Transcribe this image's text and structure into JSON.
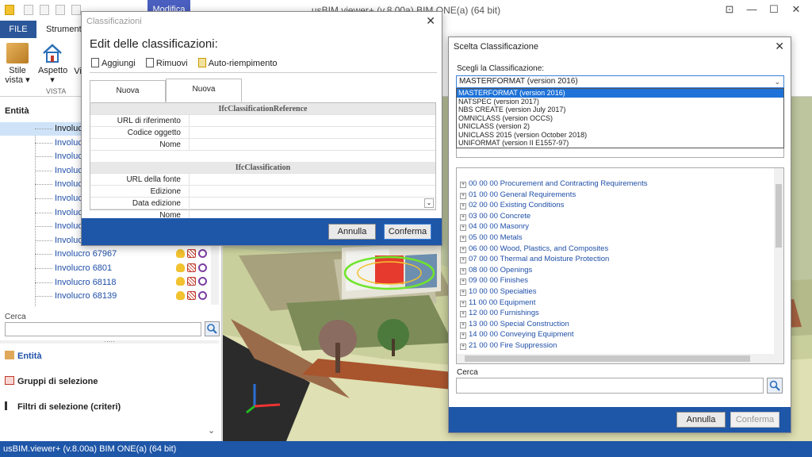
{
  "app": {
    "title": "usBIM.viewer+ (v.8.00a)  BIM ONE(a) (64 bit)",
    "context_tab": "Modifica",
    "win_controls": [
      "⊡",
      "—",
      "☐",
      "✕"
    ]
  },
  "ribbon": {
    "file_tab": "FILE",
    "tabs": [
      "Strumenti"
    ],
    "buttons": [
      {
        "label": "Stile\nvista ▾",
        "icon": "box-icon"
      },
      {
        "label": "Aspetto\n▾",
        "icon": "house-icon"
      },
      {
        "label": "Vi",
        "icon": "view-icon"
      }
    ],
    "group_label": "VISTA"
  },
  "left_panel": {
    "title": "Entità",
    "rows": [
      {
        "label": "Involucro",
        "selected": true
      },
      {
        "label": "Involucro"
      },
      {
        "label": "Involucro"
      },
      {
        "label": "Involucro"
      },
      {
        "label": "Involucro"
      },
      {
        "label": "Involucro"
      },
      {
        "label": "Involucro"
      },
      {
        "label": "Involucro"
      },
      {
        "label": "Involucro"
      },
      {
        "label": "Involucro 67967"
      },
      {
        "label": "Involucro 6801"
      },
      {
        "label": "Involucro 68118"
      },
      {
        "label": "Involucro 68139"
      }
    ],
    "search_label": "Cerca",
    "splitter": "·····",
    "nav": [
      {
        "label": "Entità",
        "active": true
      },
      {
        "label": "Gruppi di selezione"
      },
      {
        "label": "Filtri di selezione (criteri)"
      }
    ],
    "collapse": "⌄"
  },
  "statusbar": {
    "text": "usBIM.viewer+ (v.8.00a)  BIM ONE(a) (64 bit)"
  },
  "dialog_classificazioni": {
    "title": "Classificazioni",
    "heading": "Edit delle classificazioni:",
    "tools": [
      "Aggiungi",
      "Rimuovi",
      "Auto-riempimento"
    ],
    "tabs": [
      "Nuova Classificazione",
      "Nuova Classificazione"
    ],
    "sections": [
      {
        "title": "IfcClassificationReference",
        "fields": [
          "URL di riferimento",
          "Codice oggetto",
          "Nome"
        ]
      },
      {
        "title": "IfcClassification",
        "fields": [
          "URL della fonte",
          "Edizione",
          "Data edizione",
          "Nome"
        ]
      }
    ],
    "cancel": "Annulla",
    "confirm": "Conferma"
  },
  "dialog_scelta": {
    "title": "Scelta Classificazione",
    "label": "Scegli la Classificazione:",
    "selected": "MASTERFORMAT  (version 2016)",
    "options": [
      "MASTERFORMAT  (version 2016)",
      "NATSPEC  (version 2017)",
      "NBS CREATE  (version July 2017)",
      "OMNICLASS  (version OCCS)",
      "UNICLASS  (version 2)",
      "UNICLASS  2015 (version October 2018)",
      "UNIFORMAT  (version II E1557-97)"
    ],
    "tree": [
      "00 00 00 Procurement and Contracting Requirements",
      "01 00 00 General Requirements",
      "02 00 00 Existing Conditions",
      "03 00 00 Concrete",
      "04 00 00 Masonry",
      "05 00 00 Metals",
      "06 00 00 Wood, Plastics, and Composites",
      "07 00 00 Thermal and Moisture Protection",
      "08 00 00 Openings",
      "09 00 00 Finishes",
      "10 00 00 Specialties",
      "11 00 00 Equipment",
      "12 00 00 Furnishings",
      "13 00 00 Special Construction",
      "14 00 00 Conveying Equipment",
      "21 00 00 Fire Suppression"
    ],
    "search_label": "Cerca",
    "cancel": "Annulla",
    "confirm": "Conferma"
  },
  "colors": {
    "accent": "#1e56a8",
    "link": "#1f4fa8",
    "selection": "#1e72d8"
  }
}
